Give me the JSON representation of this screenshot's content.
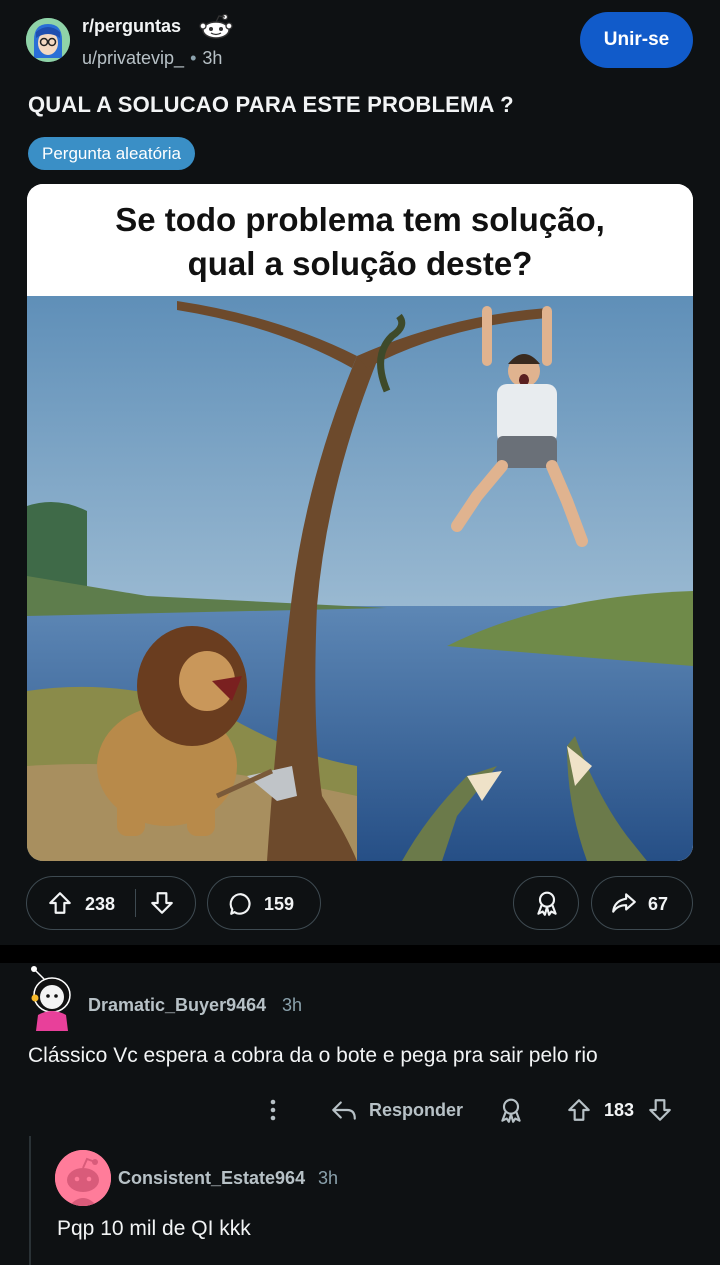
{
  "post": {
    "subreddit": "r/perguntas",
    "author": "u/privatevip_",
    "separator": "•",
    "time": "3h",
    "join_label": "Unir-se",
    "title": "QUAL A SOLUCAO PARA ESTE PROBLEMA ?",
    "flair": "Pergunta aleatória",
    "image_caption_line1": "Se todo problema tem solução,",
    "image_caption_line2": "qual a solução deste?",
    "upvotes": "238",
    "comments": "159",
    "shares": "67"
  },
  "comments": [
    {
      "author": "Dramatic_Buyer9464",
      "time": "3h",
      "body": "Clássico Vc espera a cobra da o bote e pega pra sair pelo rio",
      "reply_label": "Responder",
      "score": "183"
    },
    {
      "author": "Consistent_Estate964",
      "time": "3h",
      "body": "Pqp 10 mil de QI kkk"
    }
  ],
  "colors": {
    "background": "#0e1113",
    "join_button": "#115bca",
    "flair": "#3a8fc6",
    "text_muted": "#b7c1c6"
  },
  "icons": [
    "upvote-icon",
    "downvote-icon",
    "comment-icon",
    "award-icon",
    "share-icon",
    "more-icon",
    "reply-icon"
  ]
}
